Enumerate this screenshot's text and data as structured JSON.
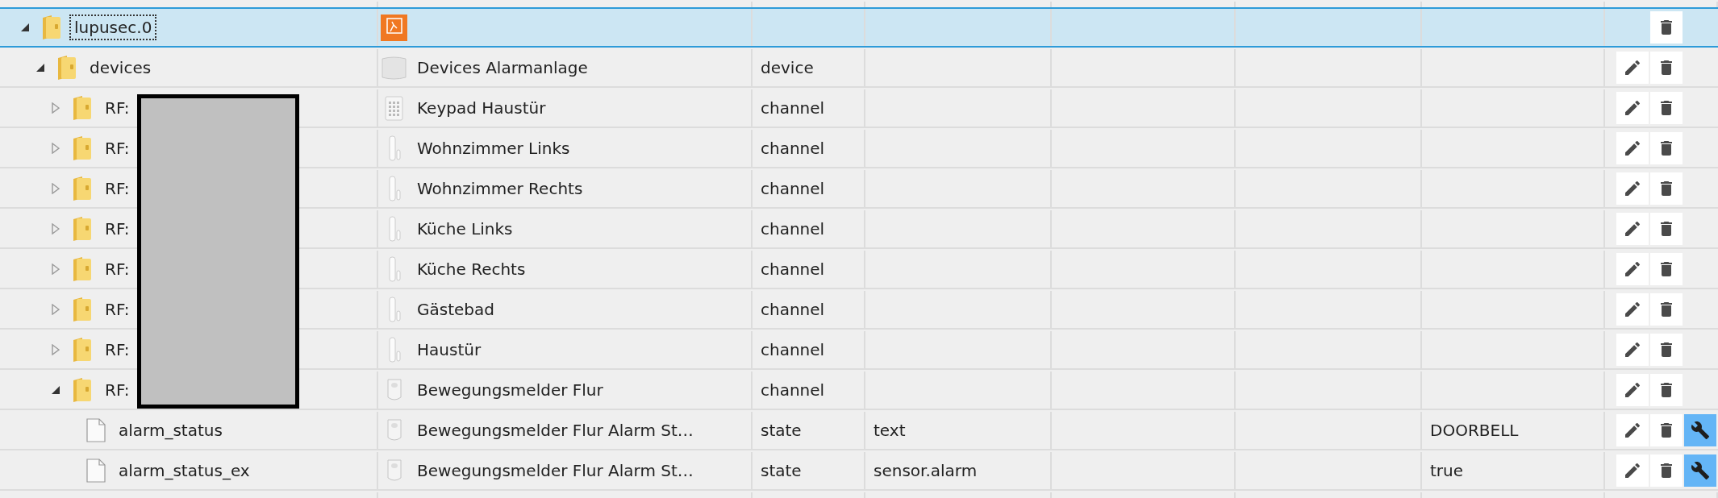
{
  "redaction_visible": true,
  "tree": [
    {
      "name": "lupusec.0",
      "kind": "folder",
      "expanded": true,
      "selected": true,
      "object": {
        "kind": "logo"
      },
      "buttons": [
        {
          "kind": "delete"
        }
      ],
      "children": [
        {
          "name": "devices",
          "kind": "folder",
          "expanded": true,
          "selected": false,
          "object": {
            "kind": "alarm-panel",
            "title": "Devices Alarmanlage"
          },
          "type": "device",
          "buttons": [
            {
              "kind": "edit"
            },
            {
              "kind": "delete"
            }
          ],
          "children": [
            {
              "name": "RF:",
              "kind": "folder",
              "expanded": false,
              "selected": false,
              "object": {
                "kind": "keypad",
                "title": "Keypad Haustür"
              },
              "type": "channel",
              "buttons": [
                {
                  "kind": "edit"
                },
                {
                  "kind": "delete"
                }
              ]
            },
            {
              "name": "RF:",
              "kind": "folder",
              "expanded": false,
              "selected": false,
              "object": {
                "kind": "door-sensor",
                "title": "Wohnzimmer Links"
              },
              "type": "channel",
              "buttons": [
                {
                  "kind": "edit"
                },
                {
                  "kind": "delete"
                }
              ]
            },
            {
              "name": "RF:",
              "kind": "folder",
              "expanded": false,
              "selected": false,
              "object": {
                "kind": "door-sensor",
                "title": "Wohnzimmer Rechts"
              },
              "type": "channel",
              "buttons": [
                {
                  "kind": "edit"
                },
                {
                  "kind": "delete"
                }
              ]
            },
            {
              "name": "RF:",
              "kind": "folder",
              "expanded": false,
              "selected": false,
              "object": {
                "kind": "door-sensor",
                "title": "Küche Links"
              },
              "type": "channel",
              "buttons": [
                {
                  "kind": "edit"
                },
                {
                  "kind": "delete"
                }
              ]
            },
            {
              "name": "RF:",
              "kind": "folder",
              "expanded": false,
              "selected": false,
              "object": {
                "kind": "door-sensor",
                "title": "Küche Rechts"
              },
              "type": "channel",
              "buttons": [
                {
                  "kind": "edit"
                },
                {
                  "kind": "delete"
                }
              ]
            },
            {
              "name": "RF:",
              "kind": "folder",
              "expanded": false,
              "selected": false,
              "object": {
                "kind": "door-sensor",
                "title": "Gästebad"
              },
              "type": "channel",
              "buttons": [
                {
                  "kind": "edit"
                },
                {
                  "kind": "delete"
                }
              ]
            },
            {
              "name": "RF:",
              "kind": "folder",
              "expanded": false,
              "selected": false,
              "object": {
                "kind": "door-sensor",
                "title": "Haustür"
              },
              "type": "channel",
              "buttons": [
                {
                  "kind": "edit"
                },
                {
                  "kind": "delete"
                }
              ]
            },
            {
              "name": "RF:",
              "kind": "folder",
              "expanded": true,
              "selected": false,
              "object": {
                "kind": "motion-sensor",
                "title": "Bewegungsmelder Flur"
              },
              "type": "channel",
              "buttons": [
                {
                  "kind": "edit"
                },
                {
                  "kind": "delete"
                }
              ],
              "children": [
                {
                  "name": "alarm_status",
                  "kind": "file",
                  "selected": false,
                  "object": {
                    "kind": "motion-sensor",
                    "title": "Bewegungsmelder Flur Alarm St…"
                  },
                  "type": "state",
                  "role": "text",
                  "value": "DOORBELL",
                  "buttons": [
                    {
                      "kind": "edit"
                    },
                    {
                      "kind": "delete"
                    },
                    {
                      "kind": "settings"
                    }
                  ]
                },
                {
                  "name": "alarm_status_ex",
                  "kind": "file",
                  "selected": false,
                  "object": {
                    "kind": "motion-sensor",
                    "title": "Bewegungsmelder Flur Alarm St…"
                  },
                  "type": "state",
                  "role": "sensor.alarm",
                  "value": "true",
                  "buttons": [
                    {
                      "kind": "edit"
                    },
                    {
                      "kind": "delete"
                    },
                    {
                      "kind": "settings"
                    }
                  ]
                }
              ]
            }
          ]
        }
      ]
    }
  ]
}
